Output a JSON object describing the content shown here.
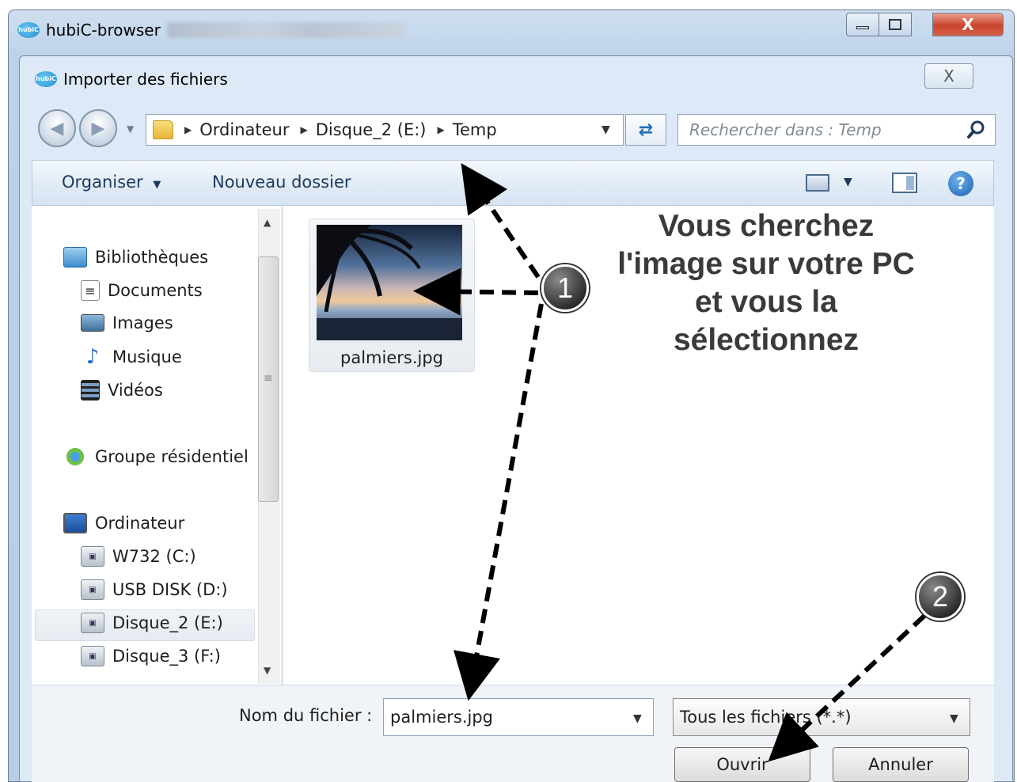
{
  "window": {
    "title": "hubiC-browser",
    "close_glyph": "X"
  },
  "dialog": {
    "title": "Importer des fichiers",
    "close_glyph": "X"
  },
  "address": {
    "crumbs": [
      "Ordinateur",
      "Disque_2 (E:)",
      "Temp"
    ],
    "search_placeholder": "Rechercher dans : Temp"
  },
  "toolbar": {
    "organise": "Organiser",
    "new_folder": "Nouveau dossier",
    "help_glyph": "?"
  },
  "sidebar": {
    "libraries": "Bibliothèques",
    "documents": "Documents",
    "images": "Images",
    "music": "Musique",
    "videos": "Vidéos",
    "homegroup": "Groupe résidentiel",
    "computer": "Ordinateur",
    "drive_c": "W732 (C:)",
    "drive_d": "USB DISK (D:)",
    "drive_e": "Disque_2 (E:)",
    "drive_f": "Disque_3 (F:)",
    "selected": "Disque_2 (E:)"
  },
  "files": [
    {
      "name": "palmiers.jpg",
      "icon": "image-thumbnail"
    }
  ],
  "annotation": {
    "lines": [
      "Vous cherchez",
      "l'image sur votre PC",
      "et vous la",
      "sélectionnez"
    ],
    "badge_1": "1",
    "badge_2": "2"
  },
  "bottom": {
    "filename_label": "Nom du fichier :",
    "filename_value": "palmiers.jpg",
    "filetype_value": "Tous les fichiers (*.*)",
    "open": "Ouvrir",
    "cancel": "Annuler"
  },
  "colors": {
    "accent": "#1e395b",
    "dialog_bg": "#dde9f6",
    "close_red": "#c9432b"
  }
}
